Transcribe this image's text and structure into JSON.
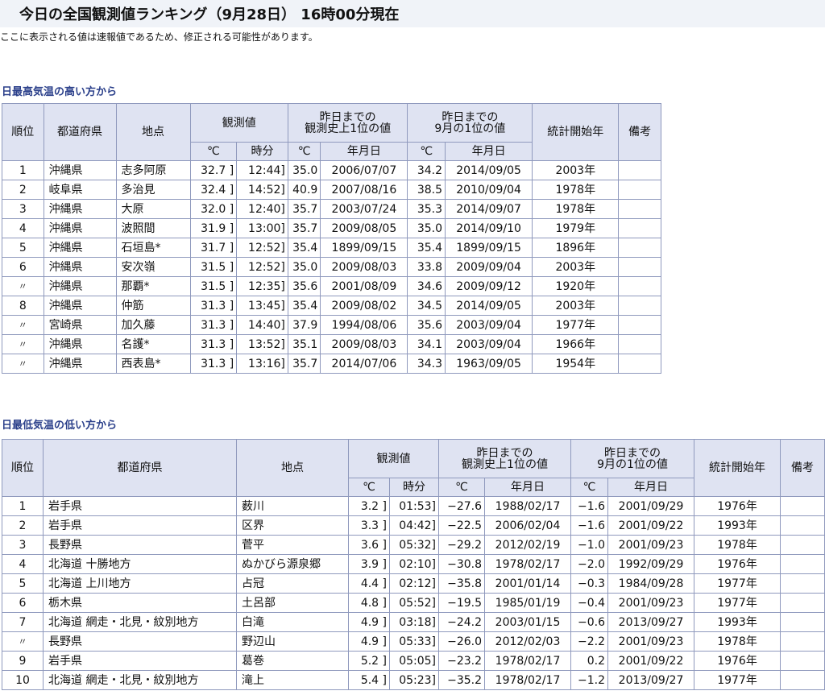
{
  "title": "今日の全国観測値ランキング（9月28日） 16時00分現在",
  "notice": "ここに表示される値は速報値であるため、修正される可能性があります。",
  "headers": {
    "rank": "順位",
    "pref": "都道府県",
    "point": "地点",
    "obs": "観測値",
    "record_all_l1": "昨日までの",
    "record_all_l2": "観測史上1位の値",
    "record_month_l1": "昨日までの",
    "record_month_l2": "9月の1位の値",
    "start_year": "統計開始年",
    "remarks": "備考",
    "unit_c": "℃",
    "time": "時分",
    "date": "年月日"
  },
  "high": {
    "title": "日最高気温の高い方から",
    "rows": [
      {
        "rank": "1",
        "pref": "沖縄県",
        "point": "志多阿原",
        "val": "32.7 ]",
        "time": "12:44]",
        "rec": "35.0",
        "rec_date": "2006/07/07",
        "mon": "34.2",
        "mon_date": "2014/09/05",
        "start": "2003年",
        "note": ""
      },
      {
        "rank": "2",
        "pref": "岐阜県",
        "point": "多治見",
        "val": "32.4 ]",
        "time": "14:52]",
        "rec": "40.9",
        "rec_date": "2007/08/16",
        "mon": "38.5",
        "mon_date": "2010/09/04",
        "start": "1978年",
        "note": ""
      },
      {
        "rank": "3",
        "pref": "沖縄県",
        "point": "大原",
        "val": "32.0 ]",
        "time": "12:40]",
        "rec": "35.7",
        "rec_date": "2003/07/24",
        "mon": "35.3",
        "mon_date": "2014/09/07",
        "start": "1978年",
        "note": ""
      },
      {
        "rank": "4",
        "pref": "沖縄県",
        "point": "波照間",
        "val": "31.9 ]",
        "time": "13:00]",
        "rec": "35.7",
        "rec_date": "2009/08/05",
        "mon": "35.0",
        "mon_date": "2014/09/10",
        "start": "1979年",
        "note": ""
      },
      {
        "rank": "5",
        "pref": "沖縄県",
        "point": "石垣島*",
        "val": "31.7 ]",
        "time": "12:52]",
        "rec": "35.4",
        "rec_date": "1899/09/15",
        "mon": "35.4",
        "mon_date": "1899/09/15",
        "start": "1896年",
        "note": ""
      },
      {
        "rank": "6",
        "pref": "沖縄県",
        "point": "安次嶺",
        "val": "31.5 ]",
        "time": "12:52]",
        "rec": "35.0",
        "rec_date": "2009/08/03",
        "mon": "33.8",
        "mon_date": "2009/09/04",
        "start": "2003年",
        "note": ""
      },
      {
        "rank": "〃",
        "pref": "沖縄県",
        "point": "那覇*",
        "val": "31.5 ]",
        "time": "12:35]",
        "rec": "35.6",
        "rec_date": "2001/08/09",
        "mon": "34.6",
        "mon_date": "2009/09/12",
        "start": "1920年",
        "note": ""
      },
      {
        "rank": "8",
        "pref": "沖縄県",
        "point": "仲筋",
        "val": "31.3 ]",
        "time": "13:45]",
        "rec": "35.4",
        "rec_date": "2009/08/02",
        "mon": "34.5",
        "mon_date": "2014/09/05",
        "start": "2003年",
        "note": ""
      },
      {
        "rank": "〃",
        "pref": "宮崎県",
        "point": "加久藤",
        "val": "31.3 ]",
        "time": "14:40]",
        "rec": "37.9",
        "rec_date": "1994/08/06",
        "mon": "35.6",
        "mon_date": "2003/09/04",
        "start": "1977年",
        "note": ""
      },
      {
        "rank": "〃",
        "pref": "沖縄県",
        "point": "名護*",
        "val": "31.3 ]",
        "time": "13:52]",
        "rec": "35.1",
        "rec_date": "2009/08/03",
        "mon": "34.1",
        "mon_date": "2003/09/04",
        "start": "1966年",
        "note": ""
      },
      {
        "rank": "〃",
        "pref": "沖縄県",
        "point": "西表島*",
        "val": "31.3 ]",
        "time": "13:16]",
        "rec": "35.7",
        "rec_date": "2014/07/06",
        "mon": "34.3",
        "mon_date": "1963/09/05",
        "start": "1954年",
        "note": ""
      }
    ]
  },
  "low": {
    "title": "日最低気温の低い方から",
    "rows": [
      {
        "rank": "1",
        "pref": "岩手県",
        "point": "薮川",
        "val": "3.2 ]",
        "time": "01:53]",
        "rec": "−27.6",
        "rec_date": "1988/02/17",
        "mon": "−1.6",
        "mon_date": "2001/09/29",
        "start": "1976年",
        "note": ""
      },
      {
        "rank": "2",
        "pref": "岩手県",
        "point": "区界",
        "val": "3.3 ]",
        "time": "04:42]",
        "rec": "−22.5",
        "rec_date": "2006/02/04",
        "mon": "−1.6",
        "mon_date": "2001/09/22",
        "start": "1993年",
        "note": ""
      },
      {
        "rank": "3",
        "pref": "長野県",
        "point": "菅平",
        "val": "3.6 ]",
        "time": "05:32]",
        "rec": "−29.2",
        "rec_date": "2012/02/19",
        "mon": "−1.0",
        "mon_date": "2001/09/23",
        "start": "1978年",
        "note": ""
      },
      {
        "rank": "4",
        "pref": "北海道 十勝地方",
        "point": "ぬかびら源泉郷",
        "val": "3.9 ]",
        "time": "02:10]",
        "rec": "−30.8",
        "rec_date": "1978/02/17",
        "mon": "−2.0",
        "mon_date": "1992/09/29",
        "start": "1976年",
        "note": ""
      },
      {
        "rank": "5",
        "pref": "北海道 上川地方",
        "point": "占冠",
        "val": "4.4 ]",
        "time": "02:12]",
        "rec": "−35.8",
        "rec_date": "2001/01/14",
        "mon": "−0.3",
        "mon_date": "1984/09/28",
        "start": "1977年",
        "note": ""
      },
      {
        "rank": "6",
        "pref": "栃木県",
        "point": "土呂部",
        "val": "4.8 ]",
        "time": "05:52]",
        "rec": "−19.5",
        "rec_date": "1985/01/19",
        "mon": "−0.4",
        "mon_date": "2001/09/23",
        "start": "1977年",
        "note": ""
      },
      {
        "rank": "7",
        "pref": "北海道 網走・北見・紋別地方",
        "point": "白滝",
        "val": "4.9 ]",
        "time": "03:18]",
        "rec": "−24.2",
        "rec_date": "2003/01/15",
        "mon": "−0.6",
        "mon_date": "2013/09/27",
        "start": "1993年",
        "note": ""
      },
      {
        "rank": "〃",
        "pref": "長野県",
        "point": "野辺山",
        "val": "4.9 ]",
        "time": "05:33]",
        "rec": "−26.0",
        "rec_date": "2012/02/03",
        "mon": "−2.2",
        "mon_date": "2001/09/23",
        "start": "1978年",
        "note": ""
      },
      {
        "rank": "9",
        "pref": "岩手県",
        "point": "葛巻",
        "val": "5.2 ]",
        "time": "05:05]",
        "rec": "−23.2",
        "rec_date": "1978/02/17",
        "mon": "0.2",
        "mon_date": "2001/09/22",
        "start": "1976年",
        "note": ""
      },
      {
        "rank": "10",
        "pref": "北海道 網走・北見・紋別地方",
        "point": "滝上",
        "val": "5.4 ]",
        "time": "05:23]",
        "rec": "−35.2",
        "rec_date": "1978/02/17",
        "mon": "−1.2",
        "mon_date": "2013/09/27",
        "start": "1977年",
        "note": ""
      }
    ]
  }
}
